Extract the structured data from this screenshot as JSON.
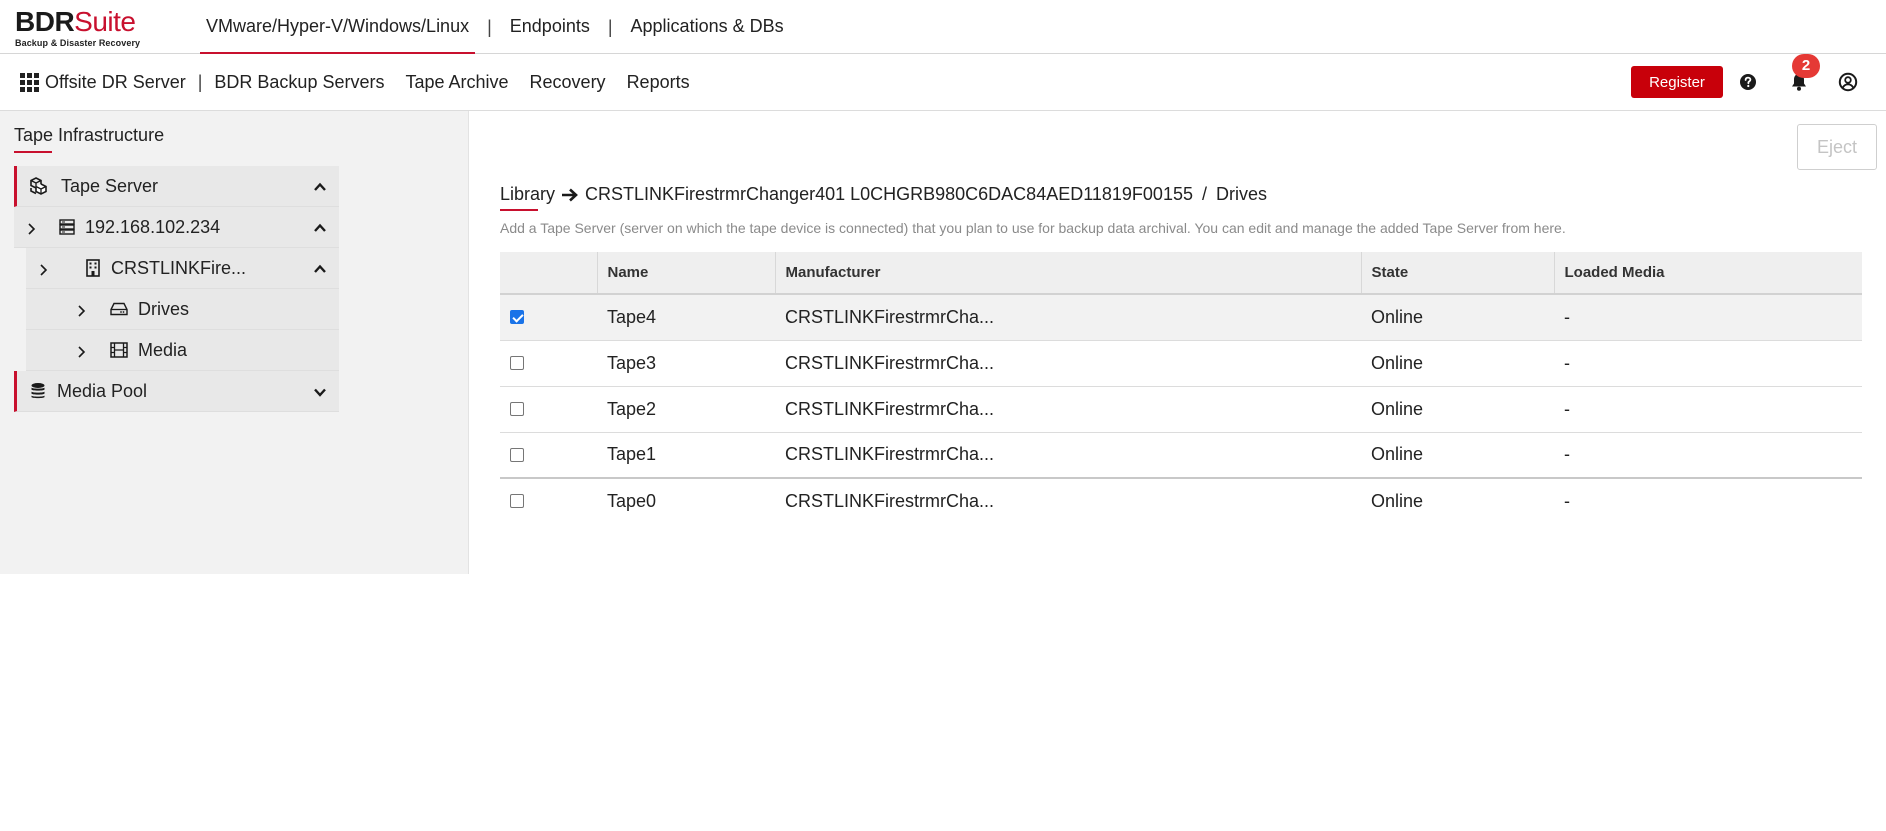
{
  "logo": {
    "bdr": "BDR",
    "suite": "Suite",
    "tagline": "Backup & Disaster Recovery"
  },
  "product_tabs": [
    {
      "label": "VMware/Hyper-V/Windows/Linux",
      "active": true
    },
    {
      "label": "Endpoints",
      "active": false
    },
    {
      "label": "Applications & DBs",
      "active": false
    }
  ],
  "separator": "|",
  "nav": {
    "home": "Offsite DR Server",
    "items": [
      "BDR Backup Servers",
      "Tape Archive",
      "Recovery",
      "Reports"
    ],
    "register_label": "Register",
    "notification_count": "2"
  },
  "sidebar": {
    "title": "Tape Infrastructure",
    "tape_server": "Tape Server",
    "server_ip": "192.168.102.234",
    "changer": "CRSTLINKFire...",
    "drives": "Drives",
    "media": "Media",
    "media_pool": "Media Pool"
  },
  "main": {
    "eject_label": "Eject",
    "breadcrumb": {
      "library": "Library",
      "changer": "CRSTLINKFirestrmrChanger401 L0CHGRB980C6DAC84AED11819F00155",
      "slash": "/",
      "drives": "Drives"
    },
    "description": "Add a Tape Server (server on which the tape device is connected) that you plan to use for backup data archival. You can edit and manage the added Tape Server from here.",
    "table": {
      "headers": [
        "Name",
        "Manufacturer",
        "State",
        "Loaded Media"
      ],
      "rows": [
        {
          "name": "Tape4",
          "manufacturer": "CRSTLINKFirestrmrCha...",
          "state": "Online",
          "loaded_media": "-",
          "checked": true
        },
        {
          "name": "Tape3",
          "manufacturer": "CRSTLINKFirestrmrCha...",
          "state": "Online",
          "loaded_media": "-",
          "checked": false
        },
        {
          "name": "Tape2",
          "manufacturer": "CRSTLINKFirestrmrCha...",
          "state": "Online",
          "loaded_media": "-",
          "checked": false
        },
        {
          "name": "Tape1",
          "manufacturer": "CRSTLINKFirestrmrCha...",
          "state": "Online",
          "loaded_media": "-",
          "checked": false
        },
        {
          "name": "Tape0",
          "manufacturer": "CRSTLINKFirestrmrCha...",
          "state": "Online",
          "loaded_media": "-",
          "checked": false
        }
      ]
    }
  },
  "colors": {
    "accent": "#c8102e",
    "register": "#c8000a",
    "badge": "#e53935",
    "checkbox": "#1a73e8"
  }
}
